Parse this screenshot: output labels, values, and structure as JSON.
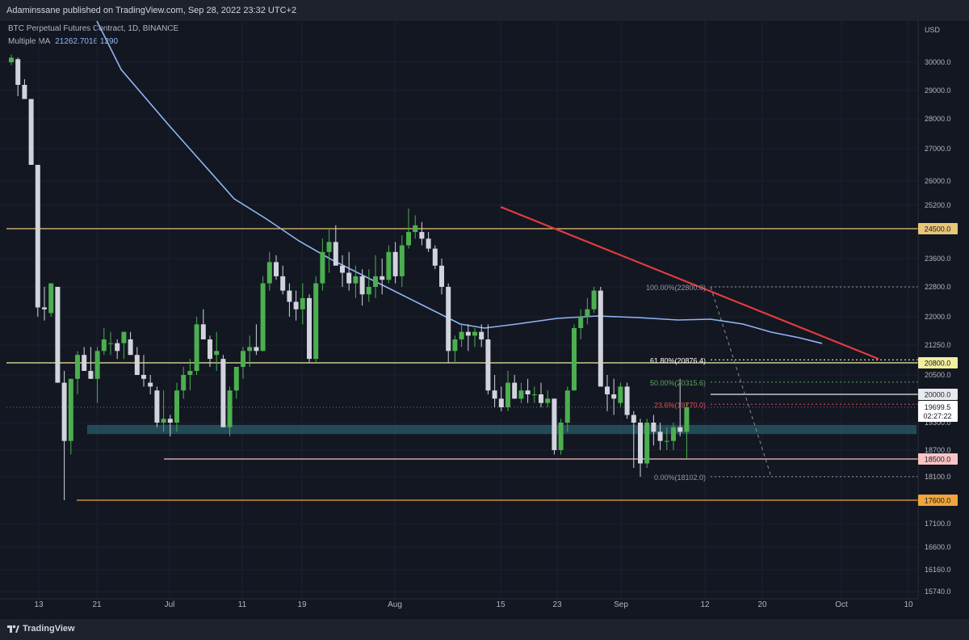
{
  "header": {
    "published": "Adaminssane published on TradingView.com, Sep 28, 2022 23:32 UTC+2"
  },
  "legend": {
    "symbol": "BTC Perpetual Futures Contract, 1D, BINANCE",
    "ma_label": "Multiple MA",
    "ma_value": "21262.7016 1290"
  },
  "footer": {
    "brand": "TradingView"
  },
  "chart_data": {
    "type": "candlestick",
    "currency": "USD",
    "y_ticks": [
      30000,
      29000,
      28000,
      27000,
      26000,
      25200,
      23600,
      22800,
      22000,
      21250,
      20500,
      19300,
      18700,
      18100,
      17100,
      16600,
      16160,
      15740
    ],
    "x_ticks": [
      "13",
      "21",
      "Jul",
      "11",
      "19",
      "Aug",
      "15",
      "23",
      "Sep",
      "12",
      "20",
      "Oct",
      "10"
    ],
    "horizontal_levels": [
      {
        "label": "24500.0",
        "value": 24500,
        "color": "#e8c67a"
      },
      {
        "label": "20800.0",
        "value": 20800,
        "color": "#f2ee9d"
      },
      {
        "label": "20000.0",
        "value": 20000,
        "color": "#e8eaef"
      },
      {
        "label": "18500.0",
        "value": 18500,
        "color": "#f8c4c4"
      },
      {
        "label": "17600.0",
        "value": 17600,
        "color": "#f0a63c"
      }
    ],
    "current_price": {
      "value": "19699.5",
      "countdown": "02:27:22"
    },
    "support_zone": [
      19050,
      19250
    ],
    "fib_levels": [
      {
        "label": "100.00%(22800.0)",
        "value": 22800
      },
      {
        "label": "61.80%(20876.4)",
        "value": 20876.4
      },
      {
        "label": "50.00%(20315.6)",
        "value": 20315.6
      },
      {
        "label": "23.6%(19770.0)",
        "value": 19770
      },
      {
        "label": "0.00%(18102.0)",
        "value": 18102
      }
    ],
    "trendline": {
      "start": 25150,
      "end": 20900,
      "color": "#e03c3c"
    },
    "moving_average": {
      "name": "Multiple MA",
      "value": 21262.7
    },
    "candles": [
      [
        30000,
        30250,
        29900,
        30150
      ],
      [
        30100,
        30150,
        28800,
        29200
      ],
      [
        29200,
        29400,
        28700,
        28700
      ],
      [
        28700,
        28700,
        26500,
        26500
      ],
      [
        26500,
        26500,
        22000,
        22250
      ],
      [
        22250,
        22800,
        21900,
        22200
      ],
      [
        22100,
        22800,
        22000,
        22900
      ],
      [
        22800,
        22800,
        20300,
        20300
      ],
      [
        20300,
        20600,
        17600,
        18900
      ],
      [
        18900,
        20400,
        18600,
        20400
      ],
      [
        20400,
        21100,
        20000,
        21000
      ],
      [
        21000,
        21200,
        20600,
        20600
      ],
      [
        20600,
        21200,
        20400,
        20400
      ],
      [
        20400,
        21200,
        19800,
        21100
      ],
      [
        21100,
        21700,
        21000,
        21400
      ],
      [
        21300,
        21600,
        21000,
        21300
      ],
      [
        21300,
        21400,
        20900,
        21100
      ],
      [
        21300,
        21600,
        20900,
        21600
      ],
      [
        21400,
        21600,
        21000,
        21000
      ],
      [
        21000,
        21200,
        20500,
        20500
      ],
      [
        20500,
        21000,
        20200,
        20400
      ],
      [
        20300,
        20500,
        20000,
        20200
      ],
      [
        20100,
        20200,
        19200,
        19300
      ],
      [
        19300,
        20100,
        19100,
        19400
      ],
      [
        19400,
        19500,
        19000,
        19300
      ],
      [
        19300,
        20300,
        19100,
        20100
      ],
      [
        20100,
        20700,
        19900,
        20500
      ],
      [
        20500,
        20900,
        20100,
        20600
      ],
      [
        20600,
        22000,
        20500,
        21800
      ],
      [
        21800,
        22200,
        21400,
        21400
      ],
      [
        21400,
        21500,
        20700,
        20900
      ],
      [
        21000,
        21600,
        20600,
        21100
      ],
      [
        20900,
        21000,
        19200,
        19200
      ],
      [
        19200,
        20200,
        19000,
        20100
      ],
      [
        20100,
        20700,
        19900,
        20700
      ],
      [
        20700,
        21200,
        20400,
        21100
      ],
      [
        21100,
        21500,
        20700,
        21200
      ],
      [
        21200,
        21800,
        21000,
        21100
      ],
      [
        21100,
        23100,
        21100,
        22900
      ],
      [
        22900,
        23800,
        22700,
        23500
      ],
      [
        23500,
        23700,
        23000,
        23100
      ],
      [
        23100,
        23400,
        22600,
        22700
      ],
      [
        22700,
        22900,
        22000,
        22400
      ],
      [
        22400,
        22700,
        21900,
        22200
      ],
      [
        22200,
        22900,
        21800,
        22500
      ],
      [
        22500,
        22600,
        20800,
        20900
      ],
      [
        20900,
        23100,
        20800,
        22900
      ],
      [
        22900,
        24200,
        22700,
        23800
      ],
      [
        23800,
        24500,
        23200,
        24100
      ],
      [
        24100,
        24600,
        23600,
        23400
      ],
      [
        23400,
        23700,
        22800,
        23200
      ],
      [
        23200,
        23800,
        22700,
        22900
      ],
      [
        22900,
        23400,
        22500,
        23100
      ],
      [
        23100,
        23300,
        22300,
        22600
      ],
      [
        22600,
        23300,
        22400,
        22800
      ],
      [
        22800,
        23700,
        22500,
        23100
      ],
      [
        23100,
        23600,
        22600,
        23000
      ],
      [
        23000,
        24000,
        22900,
        23800
      ],
      [
        23800,
        24100,
        22900,
        23100
      ],
      [
        23100,
        24300,
        22800,
        24000
      ],
      [
        24000,
        25100,
        23900,
        24400
      ],
      [
        24400,
        24900,
        24200,
        24600
      ],
      [
        24400,
        24700,
        24000,
        24200
      ],
      [
        24200,
        24400,
        23800,
        23900
      ],
      [
        23900,
        24000,
        23300,
        23400
      ],
      [
        23400,
        23600,
        22600,
        22800
      ],
      [
        22800,
        22900,
        20800,
        21100
      ],
      [
        21100,
        21500,
        20800,
        21400
      ],
      [
        21400,
        21800,
        21200,
        21600
      ],
      [
        21600,
        21800,
        21100,
        21500
      ],
      [
        21500,
        21700,
        21200,
        21600
      ],
      [
        21600,
        21800,
        21200,
        21400
      ],
      [
        21400,
        21800,
        20000,
        20100
      ],
      [
        20100,
        20500,
        19700,
        19900
      ],
      [
        19900,
        20200,
        19600,
        19700
      ],
      [
        19700,
        20600,
        19600,
        20300
      ],
      [
        20300,
        20500,
        19900,
        19900
      ],
      [
        19900,
        20300,
        19800,
        20100
      ],
      [
        20100,
        20400,
        19800,
        20000
      ],
      [
        20000,
        20200,
        19800,
        20000
      ],
      [
        20000,
        20300,
        19700,
        19800
      ],
      [
        19800,
        20100,
        19700,
        19900
      ],
      [
        19900,
        19900,
        18600,
        18700
      ],
      [
        18700,
        19400,
        18600,
        19300
      ],
      [
        19300,
        20200,
        19100,
        20100
      ],
      [
        20100,
        21800,
        20100,
        21700
      ],
      [
        21700,
        22200,
        21400,
        22000
      ],
      [
        22000,
        22500,
        21800,
        22200
      ],
      [
        22200,
        22800,
        22100,
        22700
      ],
      [
        22700,
        22800,
        20300,
        20200
      ],
      [
        20200,
        20500,
        19600,
        20000
      ],
      [
        20000,
        20400,
        19500,
        19900
      ],
      [
        19800,
        20300,
        19700,
        20200
      ],
      [
        20200,
        20300,
        19400,
        19500
      ],
      [
        19500,
        19600,
        18300,
        19300
      ],
      [
        19300,
        19400,
        18100,
        18400
      ],
      [
        18400,
        19400,
        18300,
        19300
      ],
      [
        19300,
        19500,
        18800,
        19100
      ],
      [
        19100,
        19300,
        18700,
        18900
      ],
      [
        18900,
        19200,
        18700,
        18900
      ],
      [
        18900,
        19300,
        18700,
        19200
      ],
      [
        19200,
        20400,
        19000,
        19100
      ],
      [
        19100,
        19800,
        18500,
        19700
      ]
    ]
  }
}
